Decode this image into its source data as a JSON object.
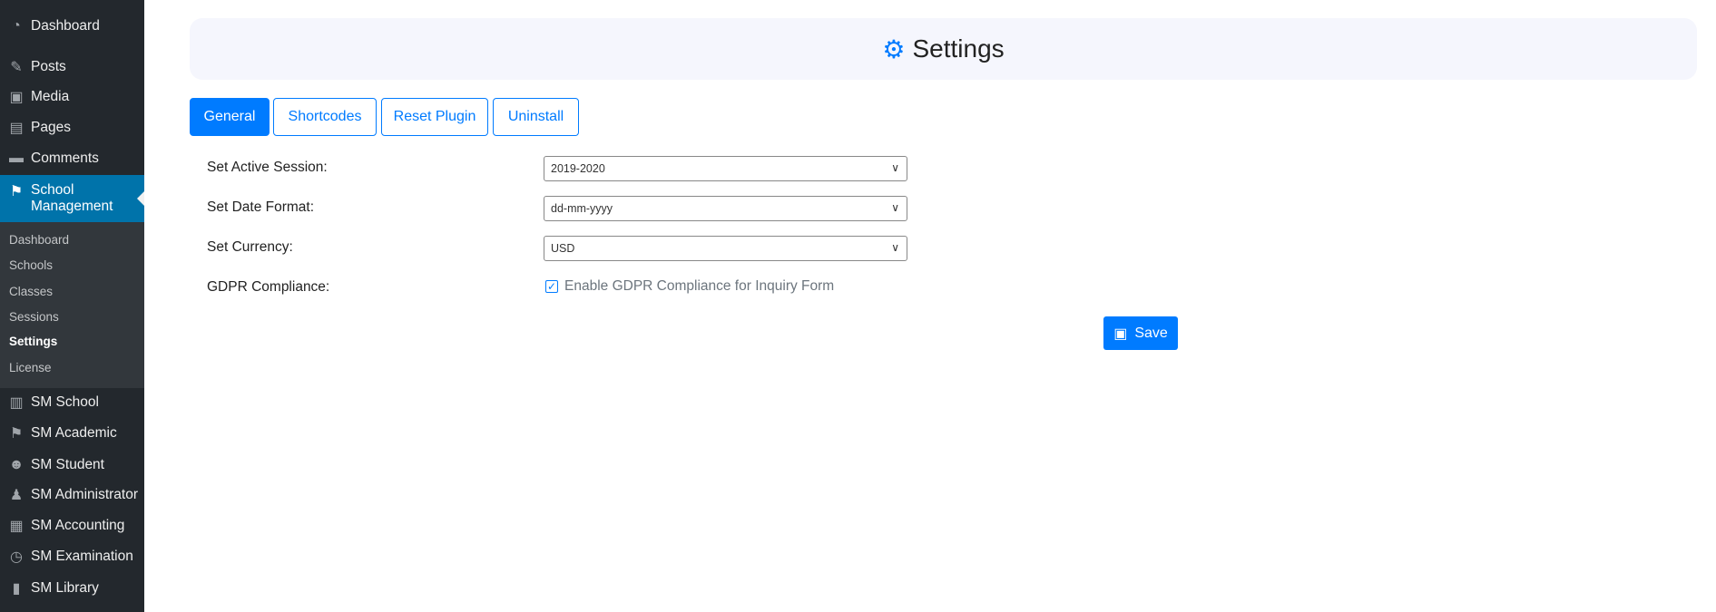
{
  "sidebar": {
    "top": [
      {
        "label": "Dashboard",
        "icon": "dashboard-icon"
      },
      {
        "label": "Posts",
        "icon": "pin-icon"
      },
      {
        "label": "Media",
        "icon": "media-icon"
      },
      {
        "label": "Pages",
        "icon": "pages-icon"
      },
      {
        "label": "Comments",
        "icon": "comment-icon"
      }
    ],
    "active": {
      "label1": "School",
      "label2": "Management"
    },
    "sub": [
      "Dashboard",
      "Schools",
      "Classes",
      "Sessions",
      "Settings",
      "License"
    ],
    "bottom": [
      "SM School",
      "SM Academic",
      "SM Student",
      "SM Administrator",
      "SM Accounting",
      "SM Examination",
      "SM Library"
    ]
  },
  "header": {
    "title": "Settings"
  },
  "tabs": [
    "General",
    "Shortcodes",
    "Reset Plugin",
    "Uninstall"
  ],
  "form": {
    "session_label": "Set Active Session:",
    "session_value": "2019-2020",
    "date_label": "Set Date Format:",
    "date_value": "dd-mm-yyyy",
    "currency_label": "Set Currency:",
    "currency_value": "USD",
    "gdpr_label": "GDPR Compliance:",
    "gdpr_checkbox": "Enable GDPR Compliance for Inquiry Form",
    "gdpr_checked": true
  },
  "save_label": "Save",
  "colors": {
    "accent": "#007bff",
    "sidebar": "#23282d",
    "active": "#0073aa"
  }
}
